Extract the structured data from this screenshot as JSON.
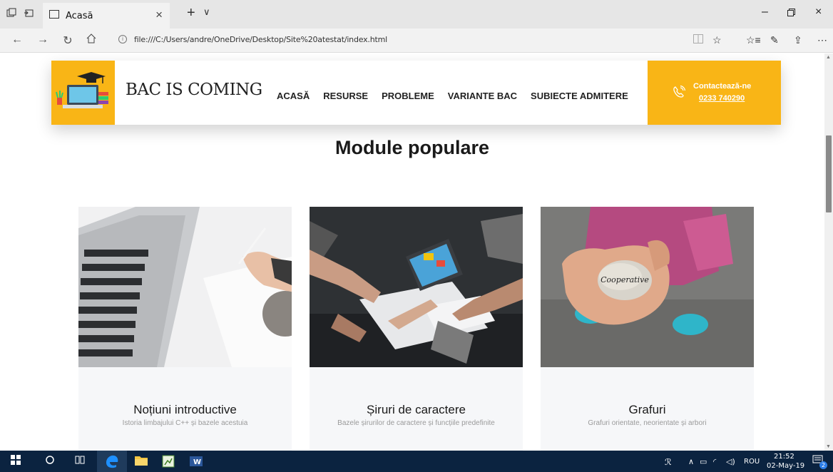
{
  "browser": {
    "tab_title": "Acasă",
    "url": "file:///C:/Users/andre/OneDrive/Desktop/Site%20atestat/index.html"
  },
  "header": {
    "brand": "BAC IS COMING",
    "nav": [
      "ACASĂ",
      "RESURSE",
      "PROBLEME",
      "VARIANTE BAC",
      "SUBIECTE ADMITERE"
    ],
    "contact_label": "Contactează-ne",
    "contact_phone": "0233 740290"
  },
  "section": {
    "title": "Module populare"
  },
  "cards": [
    {
      "title": "Noțiuni introductive",
      "desc": "Istoria limbajului C++ și bazele acestuia"
    },
    {
      "title": "Șiruri de caractere",
      "desc": "Bazele șirurilor de caractere și funcțiile predefinite"
    },
    {
      "title": "Grafuri",
      "desc": "Grafuri orientate, neorientate și arbori"
    }
  ],
  "card_image_text": "Cooperative",
  "taskbar": {
    "lang": "ROU",
    "time": "21:52",
    "date": "02-May-19",
    "notifications": "2"
  },
  "colors": {
    "accent": "#f9b516",
    "taskbar": "#0b2340"
  }
}
